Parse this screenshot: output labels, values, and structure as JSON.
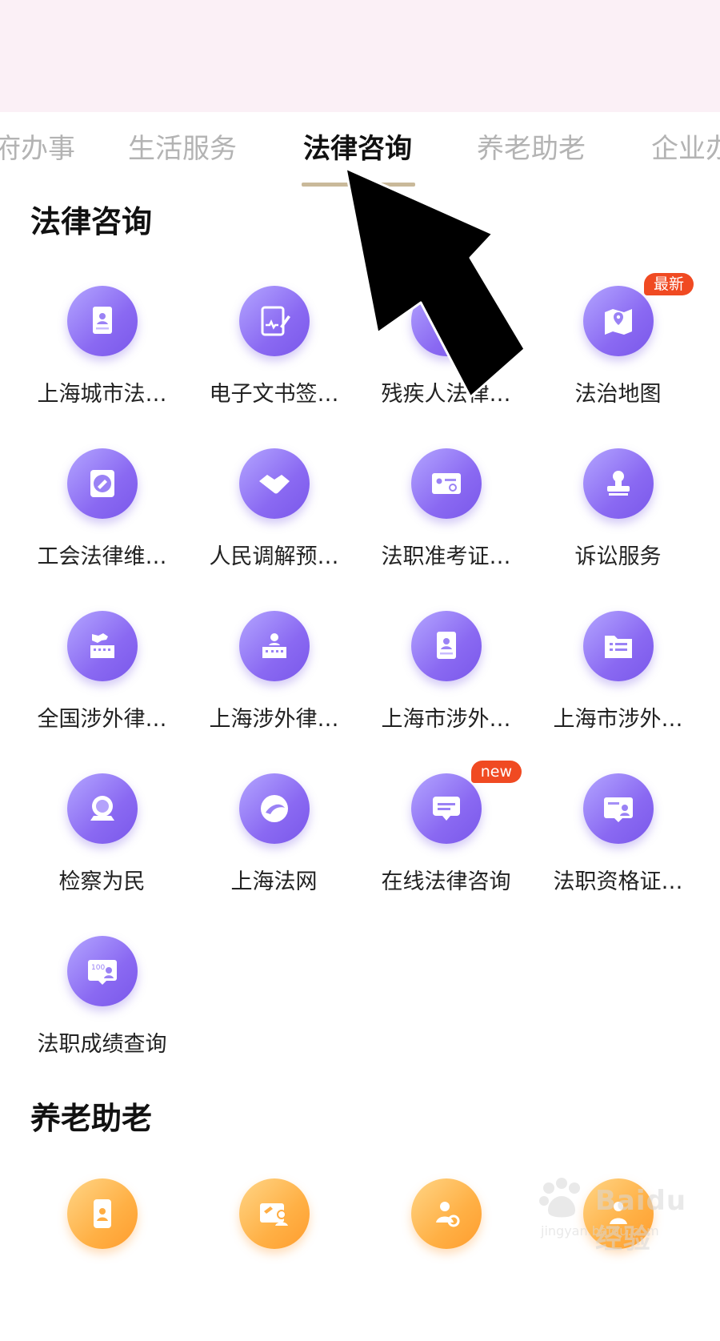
{
  "tabs": [
    "府办事",
    "生活服务",
    "法律咨询",
    "养老助老",
    "企业办"
  ],
  "active_tab": "法律咨询",
  "sections": [
    {
      "title": "法律咨询",
      "items": [
        {
          "label": "上海城市法…",
          "icon": "id-card-icon"
        },
        {
          "label": "电子文书签…",
          "icon": "tablet-sign-icon"
        },
        {
          "label": "残疾人法律…",
          "icon": "document-icon"
        },
        {
          "label": "法治地图",
          "icon": "map-pin-icon",
          "badge": "最新"
        },
        {
          "label": "工会法律维…",
          "icon": "gavel-badge-icon"
        },
        {
          "label": "人民调解预…",
          "icon": "handshake-icon"
        },
        {
          "label": "法职准考证…",
          "icon": "admission-card-icon"
        },
        {
          "label": "诉讼服务",
          "icon": "stamp-icon"
        },
        {
          "label": "全国涉外律…",
          "icon": "china-building-icon"
        },
        {
          "label": "上海涉外律…",
          "icon": "lawyer-building-icon"
        },
        {
          "label": "上海市涉外…",
          "icon": "profile-doc-icon"
        },
        {
          "label": "上海市涉外…",
          "icon": "folder-list-icon"
        },
        {
          "label": "检察为民",
          "icon": "prosecutor-icon"
        },
        {
          "label": "上海法网",
          "icon": "net-globe-icon"
        },
        {
          "label": "在线法律咨询",
          "icon": "chat-bubble-icon",
          "badge": "new"
        },
        {
          "label": "法职资格证…",
          "icon": "certificate-icon"
        },
        {
          "label": "法职成绩查询",
          "icon": "score-card-icon"
        }
      ]
    },
    {
      "title": "养老助老",
      "items": [
        {
          "label": "",
          "icon": "phone-person-icon"
        },
        {
          "label": "",
          "icon": "id-person-icon"
        },
        {
          "label": "",
          "icon": "person-search-icon"
        },
        {
          "label": "",
          "icon": "elder-icon"
        }
      ]
    }
  ],
  "watermark": {
    "brand": "Baidu经验",
    "url": "jingyan.baidu.com"
  },
  "colors": {
    "purple": "#8a69f2",
    "orange": "#ffa93c",
    "badge": "#f04a22",
    "active_underline": "#c9b99a"
  }
}
